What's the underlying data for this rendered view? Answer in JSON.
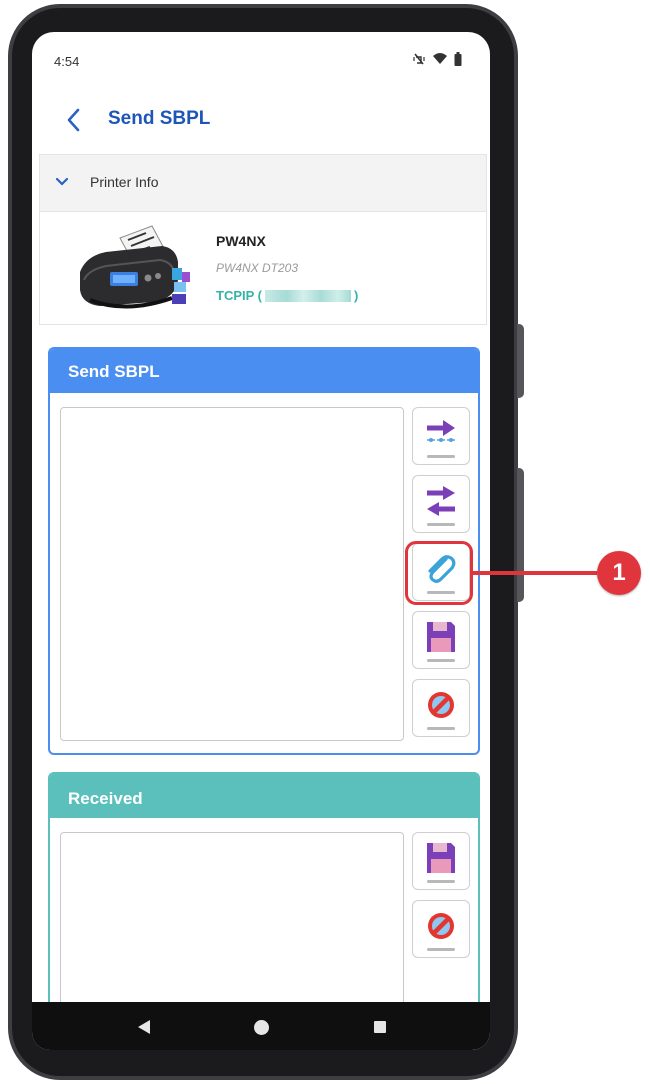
{
  "status_bar": {
    "time": "4:54"
  },
  "app_bar": {
    "title": "Send SBPL"
  },
  "printer_info": {
    "section_label": "Printer Info",
    "model": "PW4NX",
    "subtitle": "PW4NX DT203",
    "connection_prefix": "TCPIP (",
    "connection_suffix": ")"
  },
  "send_panel": {
    "header": "Send SBPL",
    "buttons": [
      {
        "icon": "send-arrow-icon"
      },
      {
        "icon": "send-receive-arrows-icon"
      },
      {
        "icon": "paperclip-icon"
      },
      {
        "icon": "floppy-disk-icon"
      },
      {
        "icon": "clear-no-icon"
      }
    ]
  },
  "received_panel": {
    "header": "Received",
    "buttons": [
      {
        "icon": "floppy-disk-icon"
      },
      {
        "icon": "clear-no-icon"
      }
    ]
  },
  "callout": {
    "number": "1",
    "color": "#e0353c"
  },
  "colors": {
    "send_header": "#4a8ef2",
    "received_header": "#5bbfbb",
    "title": "#1e56b8",
    "connection": "#34b3a6"
  }
}
